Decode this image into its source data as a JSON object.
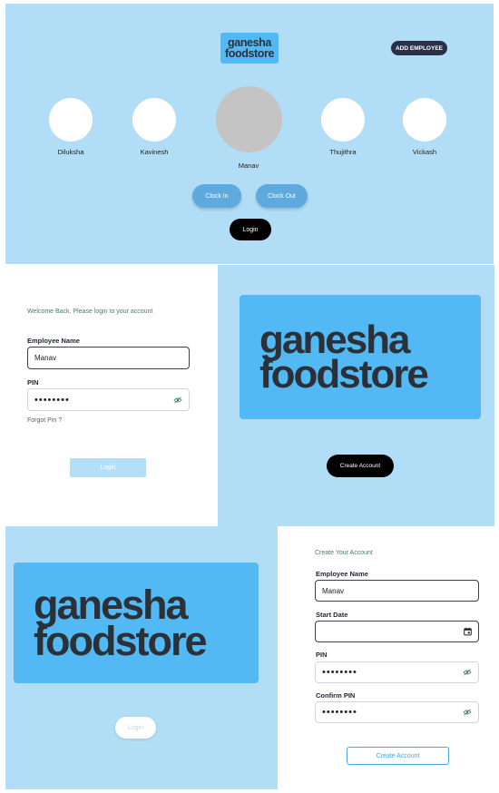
{
  "top": {
    "logo": {
      "line1": "ganesha",
      "line2": "foodstore"
    },
    "add_employee_label": "ADD EMPLOYEE",
    "employees": [
      {
        "name": "Diluksha",
        "selected": false
      },
      {
        "name": "Kavinesh",
        "selected": false
      },
      {
        "name": "Manav",
        "selected": true
      },
      {
        "name": "Thujithra",
        "selected": false
      },
      {
        "name": "Vickash",
        "selected": false
      }
    ],
    "clock_in_label": "Clock In",
    "clock_out_label": "Clock Out",
    "login_label": "Login"
  },
  "login_form": {
    "welcome": "Welcome Back, Please login to your account",
    "employee_name_label": "Employee Name",
    "employee_name_value": "Manav",
    "pin_label": "PIN",
    "pin_value": "••••••••",
    "forgot_pin": "Forgot Pin ?",
    "login_label": "Login"
  },
  "brand_panel": {
    "logo": {
      "line1": "ganesha",
      "line2": "foodstore"
    },
    "create_account_label": "Create Account"
  },
  "brand_panel_2": {
    "logo": {
      "line1": "ganesha",
      "line2": "foodstore"
    },
    "login_label": "Login"
  },
  "create_form": {
    "title": "Create Your Account",
    "employee_name_label": "Employee Name",
    "employee_name_value": "Manav",
    "start_date_label": "Start Date",
    "start_date_value": "",
    "pin_label": "PIN",
    "pin_value": "••••••••",
    "confirm_pin_label": "Confirm PIN",
    "confirm_pin_value": "••••••••",
    "create_account_label": "Create Account"
  },
  "colors": {
    "background_blue": "#b1def6",
    "logo_blue": "#52b9f4",
    "button_blue": "#5ea9de",
    "dark": "#2a3048"
  },
  "icons": [
    "eye-slash-icon",
    "calendar-icon"
  ]
}
